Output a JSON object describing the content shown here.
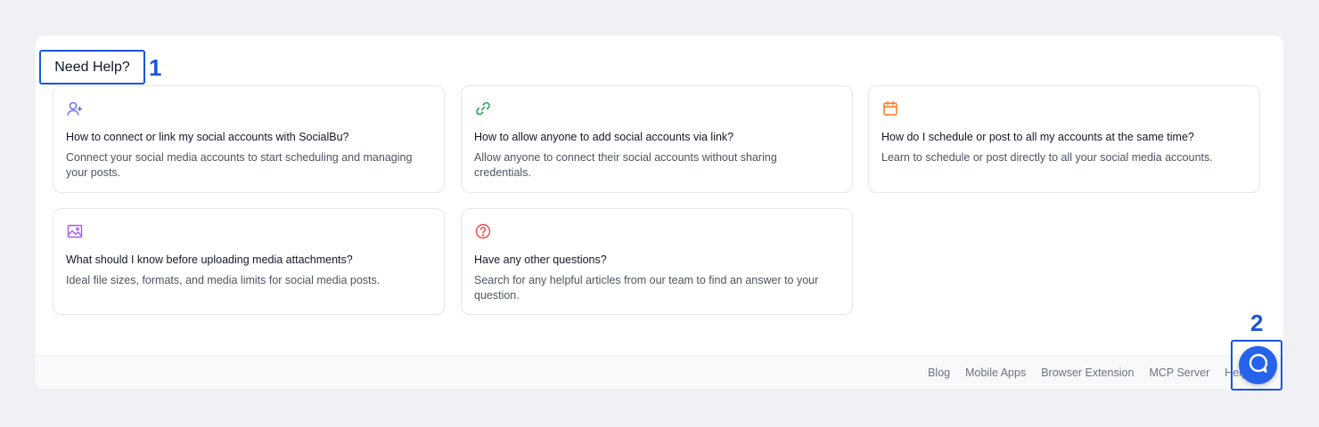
{
  "help": {
    "title": "Need Help?"
  },
  "markers": [
    "1",
    "2"
  ],
  "cards": [
    {
      "icon": "user-plus-icon",
      "color": "#6366f1",
      "question": "How to connect or link my social accounts with SocialBu?",
      "description": "Connect your social media accounts to start scheduling and managing your posts."
    },
    {
      "icon": "link-icon",
      "color": "#16a34a",
      "question": "How to allow anyone to add social accounts via link?",
      "description": "Allow anyone to connect their social accounts without sharing credentials."
    },
    {
      "icon": "calendar-icon",
      "color": "#f97316",
      "question": "How do I schedule or post to all my accounts at the same time?",
      "description": "Learn to schedule or post directly to all your social media accounts."
    },
    {
      "icon": "image-icon",
      "color": "#a855f7",
      "question": "What should I know before uploading media attachments?",
      "description": "Ideal file sizes, formats, and media limits for social media posts."
    },
    {
      "icon": "question-circle-icon",
      "color": "#ef4444",
      "question": "Have any other questions?",
      "description": "Search for any helpful articles from our team to find an answer to your question."
    }
  ],
  "footer": {
    "links": [
      "Blog",
      "Mobile Apps",
      "Browser Extension",
      "MCP Server",
      "Help"
    ]
  },
  "chat": {
    "icon": "chat-bubble-icon",
    "color": "#2563eb"
  }
}
